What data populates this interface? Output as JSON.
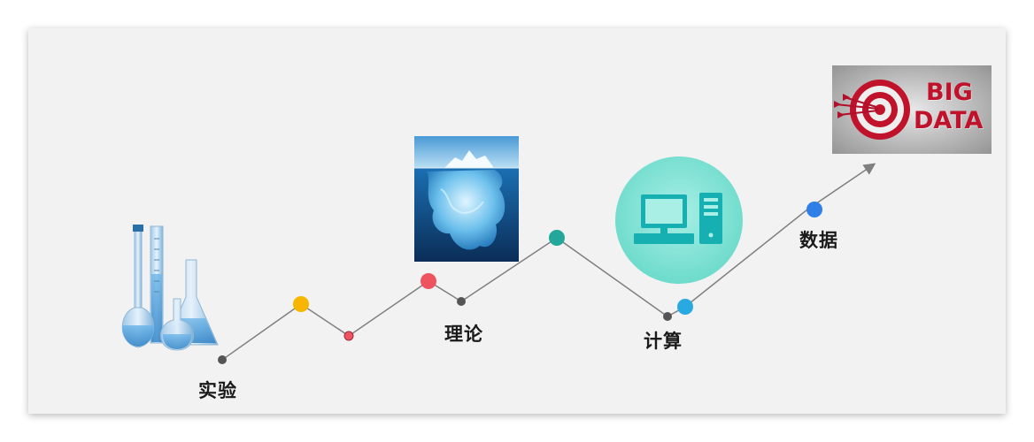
{
  "stages": {
    "experiment": "实验",
    "theory": "理论",
    "computing": "计算",
    "data": "数据"
  },
  "bigdata": {
    "line1": "BIG",
    "line2": "DATA"
  },
  "colors": {
    "line": "#7f7f7f",
    "node_dark": "#555555",
    "node_yellow": "#f7b500",
    "node_red": "#ef5360",
    "node_teal": "#22a79a",
    "node_cyan": "#29a9e1",
    "node_blue": "#2f7fe6",
    "computer_bg": "#7fe0d2",
    "computer_icon": "#17b0b2"
  },
  "icons": [
    "lab-glassware-image",
    "iceberg-image",
    "computer-icon",
    "bigdata-target-image"
  ]
}
